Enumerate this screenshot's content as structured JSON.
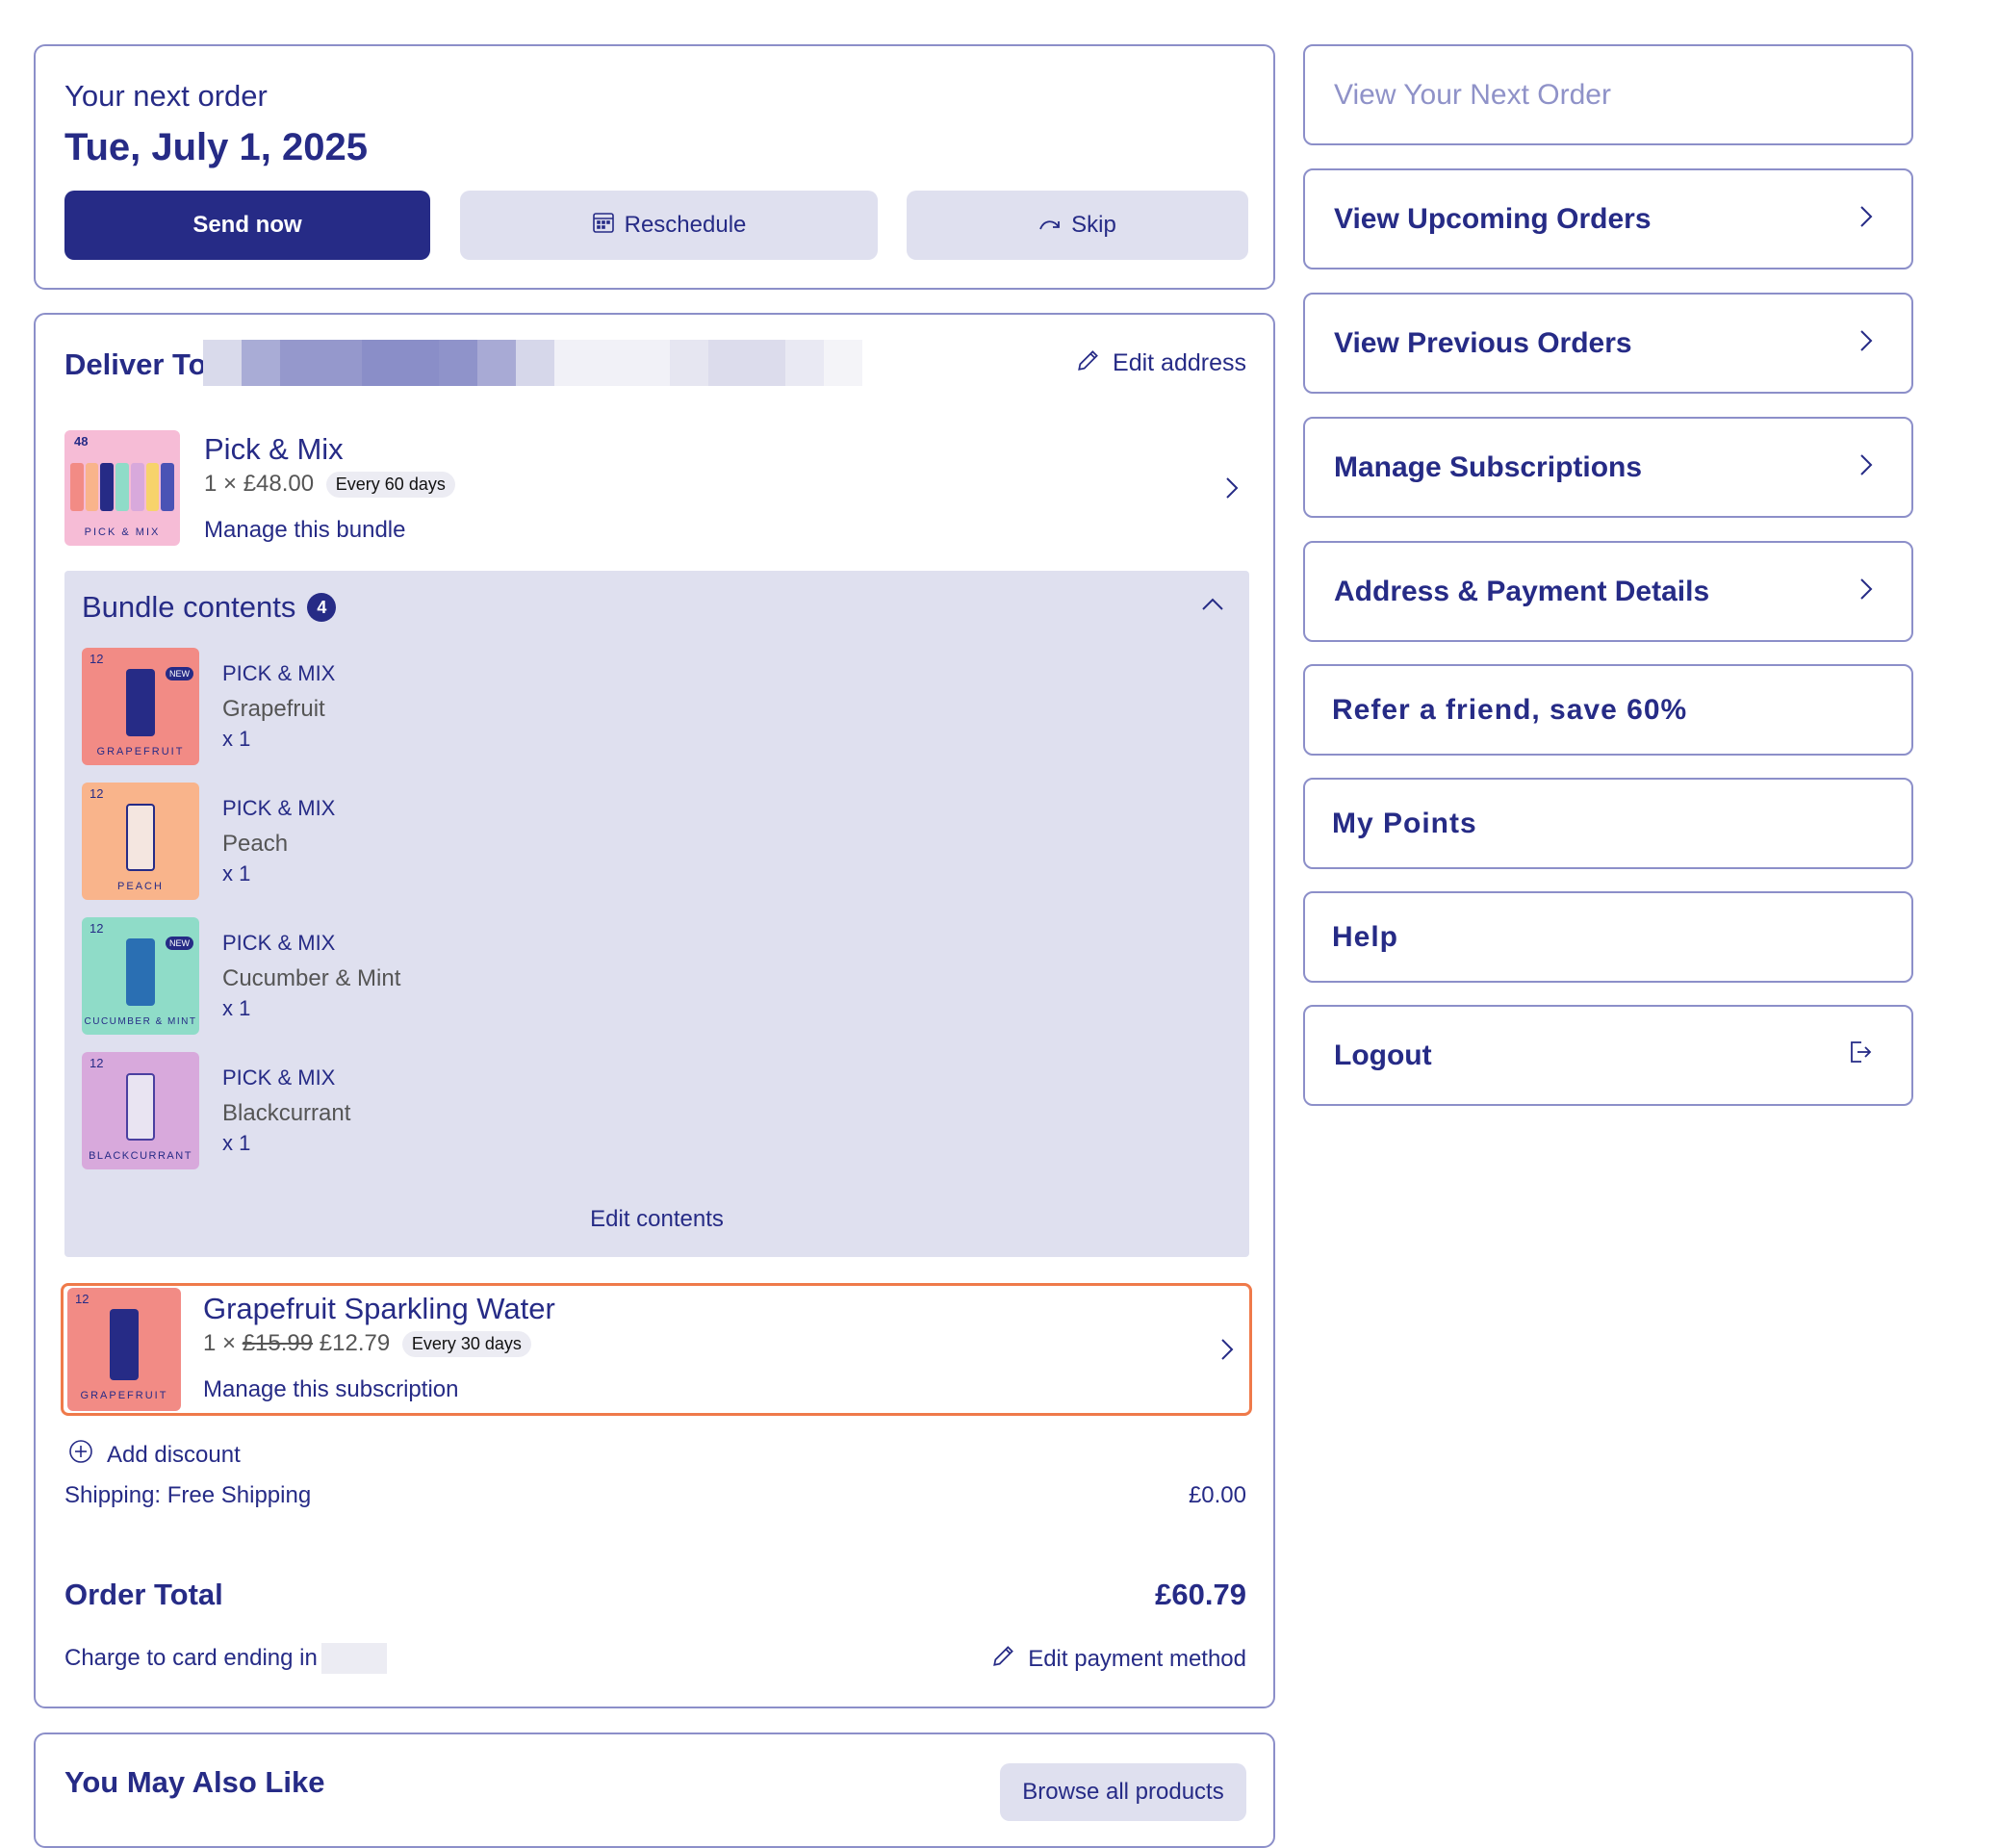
{
  "next_order": {
    "heading": "Your next order",
    "date": "Tue, July 1, 2025",
    "send_now_label": "Send now",
    "reschedule_label": "Reschedule",
    "skip_label": "Skip"
  },
  "delivery": {
    "deliver_to_label": "Deliver To",
    "edit_address_label": "Edit address"
  },
  "bundle": {
    "title": "Pick & Mix",
    "quantity_price": "1 × £48.00",
    "frequency": "Every 60 days",
    "manage_label": "Manage this bundle",
    "thumb_count": "48",
    "thumb_caption": "PICK & MIX",
    "contents_title": "Bundle contents",
    "contents_count": "4",
    "edit_contents_label": "Edit contents",
    "items": [
      {
        "brand": "PICK & MIX",
        "flavour": "Grapefruit",
        "qty": "x 1",
        "thumb_caption": "GRAPEFRUIT",
        "thumb_count": "12",
        "color": "#f28b85",
        "badge": "NEW"
      },
      {
        "brand": "PICK & MIX",
        "flavour": "Peach",
        "qty": "x 1",
        "thumb_caption": "PEACH",
        "thumb_count": "12",
        "color": "#f9b48b",
        "badge": ""
      },
      {
        "brand": "PICK & MIX",
        "flavour": "Cucumber & Mint",
        "qty": "x 1",
        "thumb_caption": "CUCUMBER & MINT",
        "thumb_count": "12",
        "color": "#8fdcc8",
        "badge": "NEW"
      },
      {
        "brand": "PICK & MIX",
        "flavour": "Blackcurrant",
        "qty": "x 1",
        "thumb_caption": "BLACKCURRANT",
        "thumb_count": "12",
        "color": "#d8a9dc",
        "badge": ""
      }
    ]
  },
  "subscription": {
    "title": "Grapefruit Sparkling Water",
    "quantity_prefix": "1 ×",
    "old_price": "£15.99",
    "new_price": "£12.79",
    "frequency": "Every 30 days",
    "manage_label": "Manage this subscription",
    "thumb_caption": "GRAPEFRUIT",
    "thumb_count": "12"
  },
  "summary": {
    "add_discount_label": "Add discount",
    "shipping_label": "Shipping: Free Shipping",
    "shipping_value": "£0.00",
    "total_label": "Order Total",
    "total_value": "£60.79",
    "charge_label": "Charge to card ending in",
    "edit_payment_label": "Edit payment method"
  },
  "recommendations": {
    "title": "You May Also Like",
    "browse_label": "Browse all products"
  },
  "sidebar": {
    "items": [
      {
        "label": "View Your Next Order"
      },
      {
        "label": "View Upcoming Orders"
      },
      {
        "label": "View Previous Orders"
      },
      {
        "label": "Manage Subscriptions"
      },
      {
        "label": "Address & Payment Details"
      },
      {
        "label": "Refer a friend, save 60%"
      },
      {
        "label": "My Points"
      },
      {
        "label": "Help"
      },
      {
        "label": "Logout"
      }
    ]
  },
  "colors": {
    "navy": "#262b86",
    "secondary_button": "#dfe0ef",
    "bundle_panel": "#dfe0ef",
    "highlight_border": "#ef7a4a"
  }
}
